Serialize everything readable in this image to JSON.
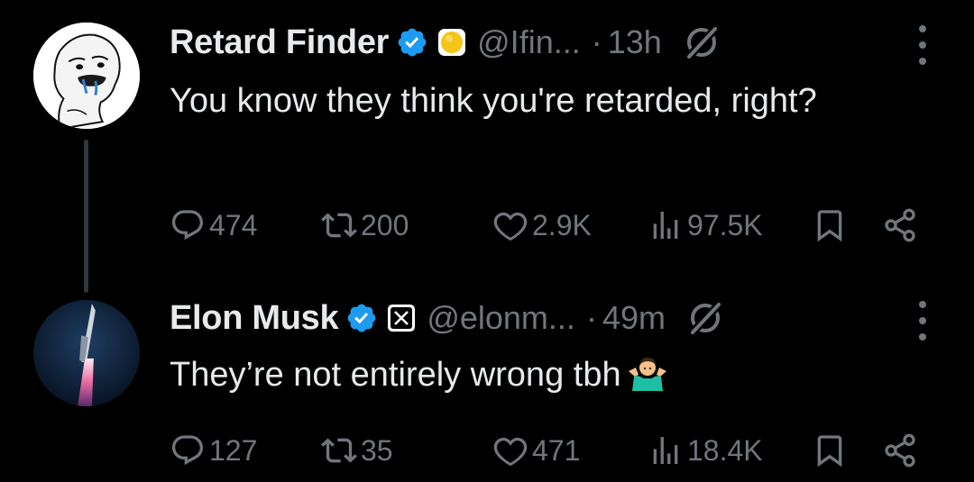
{
  "tweets": [
    {
      "name": "Retard Finder",
      "handle": "@Ifin...",
      "separator": "·",
      "time": "13h",
      "text": "You know they think you're retarded, right?",
      "stats": {
        "replies": "474",
        "retweets": "200",
        "likes": "2.9K",
        "views": "97.5K"
      }
    },
    {
      "name": "Elon Musk",
      "handle": "@elonm...",
      "separator": "·",
      "time": "49m",
      "text": "They’re not entirely wrong tbh",
      "emoji": "person-shrugging",
      "stats": {
        "replies": "127",
        "retweets": "35",
        "likes": "471",
        "views": "18.4K"
      }
    }
  ],
  "colors": {
    "background": "#000000",
    "text": "#e7e9ea",
    "muted": "#71767b",
    "verified": "#1d9bf0",
    "gold_affiliate": "#f5c518"
  },
  "icons": [
    "verified-badge-icon",
    "affiliate-gold-icon",
    "x-logo-affiliate-icon",
    "grok-icon",
    "more-icon",
    "reply-icon",
    "retweet-icon",
    "like-icon",
    "views-icon",
    "bookmark-icon",
    "share-icon"
  ]
}
